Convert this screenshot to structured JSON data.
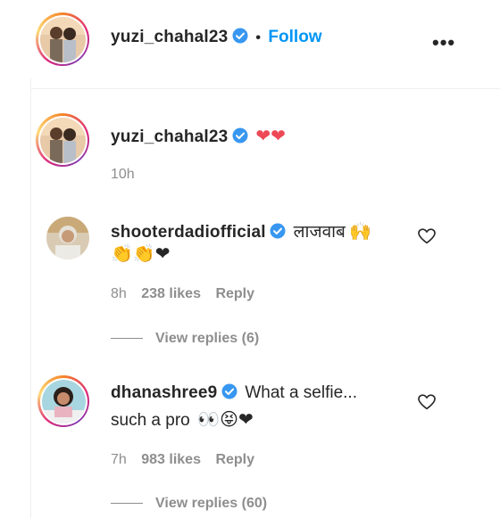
{
  "header": {
    "username": "yuzi_chahal23",
    "follow_label": "Follow",
    "bullet": "•",
    "more_icon_text": "•••"
  },
  "caption": {
    "username": "yuzi_chahal23",
    "emoji": "❤❤",
    "time": "10h"
  },
  "comments": [
    {
      "username": "shooterdadiofficial",
      "text": "लाजवाब",
      "emoji_inline": "🙌",
      "text_line2": "👏👏❤",
      "time": "8h",
      "likes": "238 likes",
      "reply_label": "Reply",
      "view_replies": "View replies (6)"
    },
    {
      "username": "dhanashree9",
      "text": "What a selfie...",
      "text_line2": "such a pro",
      "emoji_line2": "👀😝❤",
      "time": "7h",
      "likes": "983 likes",
      "reply_label": "Reply",
      "view_replies": "View replies (60)"
    }
  ],
  "colors": {
    "accent": "#0095f6",
    "heart": "#ed4956",
    "verified": "#3897f0"
  }
}
